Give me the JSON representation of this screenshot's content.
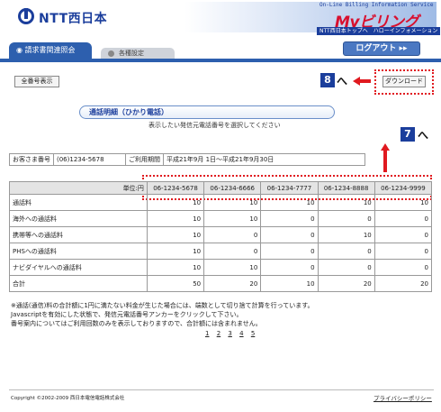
{
  "header": {
    "logo_text": "NTT西日本",
    "tagline": "On-Line Billing Information Service",
    "brand": "Myビリング",
    "links": "NTT西日本トップへ　ハローインフォメーション"
  },
  "tabs": [
    {
      "label": "請求書関連照会",
      "active": true
    },
    {
      "label": "各種設定",
      "active": false
    }
  ],
  "logout_label": "ログアウト ▸▸",
  "all_numbers_button": "全番号表示",
  "download_button": "ダウンロード",
  "callouts": {
    "download": "8",
    "table_header": "7"
  },
  "caret": "へ",
  "section_title": "通話明細（ひかり電話）",
  "instruction": "表示したい発信元電話番号を選択してください",
  "customer": {
    "number_label": "お客さま番号",
    "number_value": "(06)1234-5678",
    "period_label": "ご利用期間",
    "period_value": "平成21年9月 1日〜平成21年9月30日"
  },
  "table": {
    "unit_label": "単位:円",
    "phones": [
      "06-1234-5678",
      "06-1234-6666",
      "06-1234-7777",
      "06-1234-8888",
      "06-1234-9999"
    ],
    "rows": [
      {
        "label": "通話料",
        "values": [
          "10",
          "10",
          "10",
          "10",
          "10"
        ]
      },
      {
        "label": "海外への通話料",
        "values": [
          "10",
          "10",
          "0",
          "0",
          "0"
        ]
      },
      {
        "label": "携帯等への通話料",
        "values": [
          "10",
          "0",
          "0",
          "10",
          "0"
        ]
      },
      {
        "label": "PHSへの通話料",
        "values": [
          "10",
          "0",
          "0",
          "0",
          "0"
        ]
      },
      {
        "label": "ナビダイヤルへの通話料",
        "values": [
          "10",
          "10",
          "0",
          "0",
          "0"
        ]
      },
      {
        "label": "合計",
        "values": [
          "50",
          "20",
          "10",
          "20",
          "20"
        ]
      }
    ]
  },
  "notes": [
    "※通話(通信)料の合計額に1円に満たない料金が生じた場合には、端数として切り捨て計算を行っています。",
    "Javascriptを有効にした状態で、発信元電話番号アンカーをクリックして下さい。",
    "番号案内についてはご利用回数のみを表示しておりますので、合計額には含まれません。"
  ],
  "pages": [
    "1",
    "2",
    "3",
    "4",
    "5"
  ],
  "footer": {
    "copyright": "Copyright ©2002-2009 西日本電信電話株式会社",
    "privacy": "プライバシーポリシー"
  },
  "colors": {
    "brand_blue": "#1b3e9c",
    "brand_red": "#d8102f",
    "highlight_red": "#e0191f"
  }
}
